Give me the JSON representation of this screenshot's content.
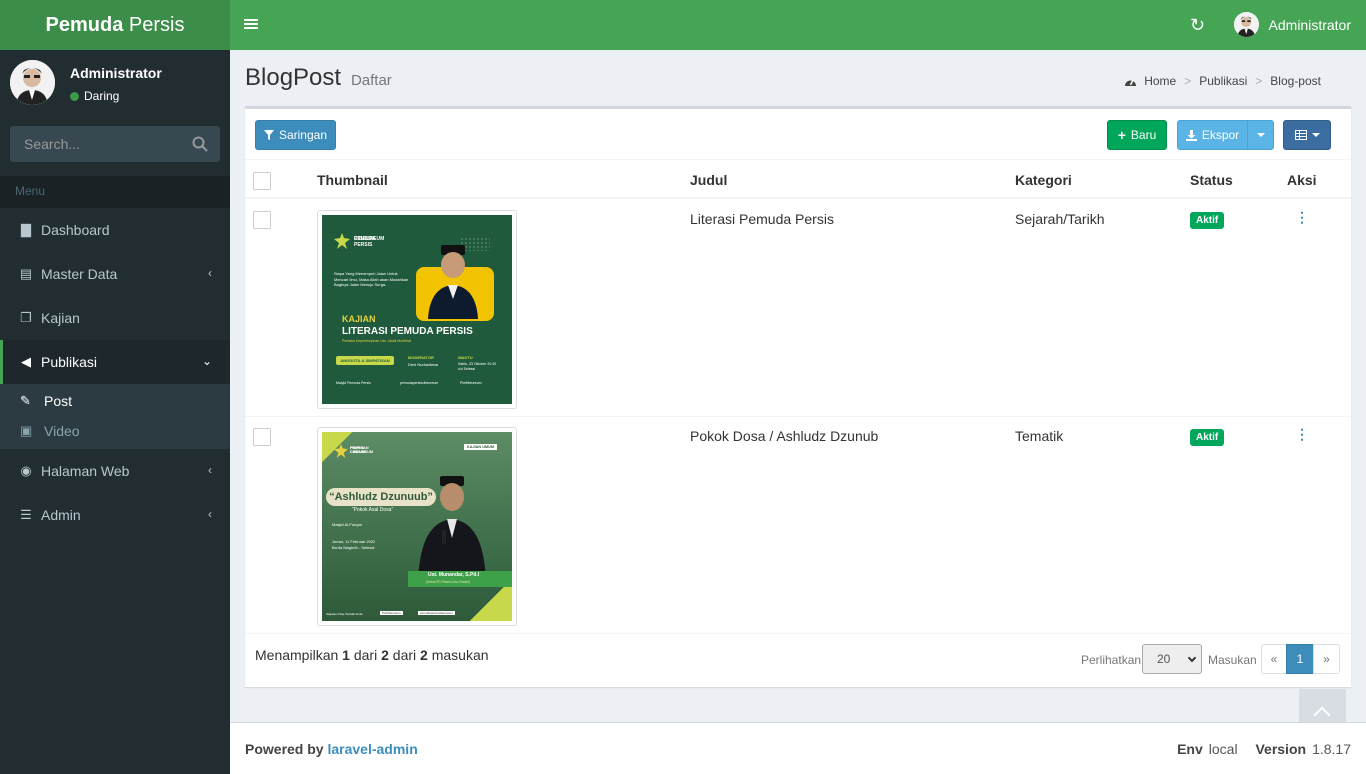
{
  "brand": {
    "bold": "Pemuda",
    "rest": "Persis"
  },
  "navbar": {
    "user_name": "Administrator"
  },
  "sidebar": {
    "user_name": "Administrator",
    "status": "Daring",
    "search_placeholder": "Search...",
    "menu_header": "Menu",
    "items": [
      {
        "label": "Dashboard",
        "icon": "bar-chart-icon"
      },
      {
        "label": "Master Data",
        "icon": "archive-icon"
      },
      {
        "label": "Kajian",
        "icon": "copy-icon"
      },
      {
        "label": "Publikasi",
        "icon": "bullhorn-icon"
      },
      {
        "label": "Halaman Web",
        "icon": "chrome-icon"
      },
      {
        "label": "Admin",
        "icon": "tasks-icon"
      }
    ],
    "subitems": [
      {
        "label": "Post",
        "icon": "edit-icon"
      },
      {
        "label": "Video",
        "icon": "file-video-icon"
      }
    ]
  },
  "header": {
    "title": "BlogPost",
    "subtitle": "Daftar"
  },
  "breadcrumb": {
    "home": "Home",
    "level1": "Publikasi",
    "level2": "Blog-post"
  },
  "toolbar": {
    "filter": "Saringan",
    "new": "Baru",
    "export": "Ekspor"
  },
  "table": {
    "columns": {
      "thumbnail": "Thumbnail",
      "title": "Judul",
      "category": "Kategori",
      "status": "Status",
      "action": "Aksi"
    },
    "rows": [
      {
        "title": "Literasi Pemuda Persis",
        "category": "Sejarah/Tarikh",
        "status": "Aktif",
        "poster": {
          "org_line1": "PEMUDA PERSIS",
          "org_line2": "CIBEUREUM",
          "quote": "Siapa Yang Menempuh Jalan Untuk Mencari Ilmu, Maka Allah akan Mudahkan Baginya Jalan Menuju Surga.",
          "label": "KAJIAN",
          "headline": "LITERASI PEMUDA PERSIS",
          "sub": "Perbaka Kepemimpinan Ust. Jalalil Mudhhar",
          "chip": "ANGGOTA & SIMPATISAN",
          "moderator_label": "MODERATOR",
          "moderator": "Deni Nurhadiana",
          "time_label": "WAKTU",
          "time": "Sabtu, 23 Oktober 20.30 s/d Selesai",
          "place": "Masjid Pemuda Persis",
          "web": "pemudapersiscibeureum",
          "fb": "Pimfibeureum"
        }
      },
      {
        "title": "Pokok Dosa / Ashludz Dzunub",
        "category": "Tematik",
        "status": "Aktif",
        "poster": {
          "org_line1": "PIMPINAN CABANG",
          "org_line2": "PERSIS CIBEUREUM",
          "tag": "KAJIAN UMUM",
          "headline": "“Ashludz Dzunuub”",
          "sub": "“Pokok Asal Dosa”",
          "place": "Masjid Al-Furqon",
          "date": "Jumat, 11 Februari 2022",
          "time": "Ba'da Maghrib - Selesai",
          "speaker": "Ust. Munandar, S.Pd.I",
          "speaker_role": "(Ketua PD Persis Kota Cimahi)",
          "footer": "Siapkan Infaq Terbaik Anda",
          "fb": "PCPibeureum",
          "ig": "pemudapersiscibeureum"
        }
      }
    ]
  },
  "pagination": {
    "showing": "Menampilkan",
    "from": "1",
    "dari1": "dari",
    "to": "2",
    "dari2": "dari",
    "total": "2",
    "masukan": "masukan",
    "per_page_label": "Perlihatkan",
    "per_page": "20",
    "entries_label": "Masukan",
    "prev": "«",
    "current": "1",
    "next": "»"
  },
  "footer": {
    "powered": "Powered by",
    "link": "laravel-admin",
    "env_label": "Env",
    "env": "local",
    "version_label": "Version",
    "version": "1.8.17"
  },
  "colors": {
    "accent": "#45a555",
    "sidebar": "#222d32",
    "primary": "#3c8dbc",
    "success": "#00a65a"
  }
}
